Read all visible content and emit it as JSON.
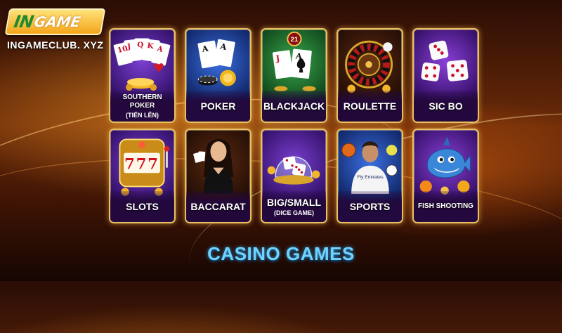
{
  "logo": {
    "brand_in": "IN",
    "brand_game": "GAME",
    "domain": "INGAMECLUB. XYZ"
  },
  "games": [
    {
      "label": "SOUTHERN POKER",
      "sublabel": "(TIẾN LÊN)"
    },
    {
      "label": "POKER"
    },
    {
      "label": "BLACKJACK",
      "badge": "21"
    },
    {
      "label": "ROULETTE"
    },
    {
      "label": "SIC BO"
    },
    {
      "label": "SLOTS",
      "reels": "777"
    },
    {
      "label": "BACCARAT"
    },
    {
      "label": "BIG/SMALL",
      "sublabel": "(DICE GAME)"
    },
    {
      "label": "SPORTS",
      "shirt_text": "Fly Emirates"
    },
    {
      "label": "FISH SHOOTING"
    }
  ],
  "cards": {
    "southern": [
      "10",
      "J",
      "Q",
      "K",
      "A"
    ],
    "poker": [
      "A",
      "A"
    ],
    "blackjack": [
      "J",
      "A"
    ]
  },
  "section_title": "CASINO GAMES",
  "colors": {
    "frame_gold": "#e9c061",
    "title_blue": "#6fd3ff",
    "logo_green": "#1f8a2e"
  }
}
